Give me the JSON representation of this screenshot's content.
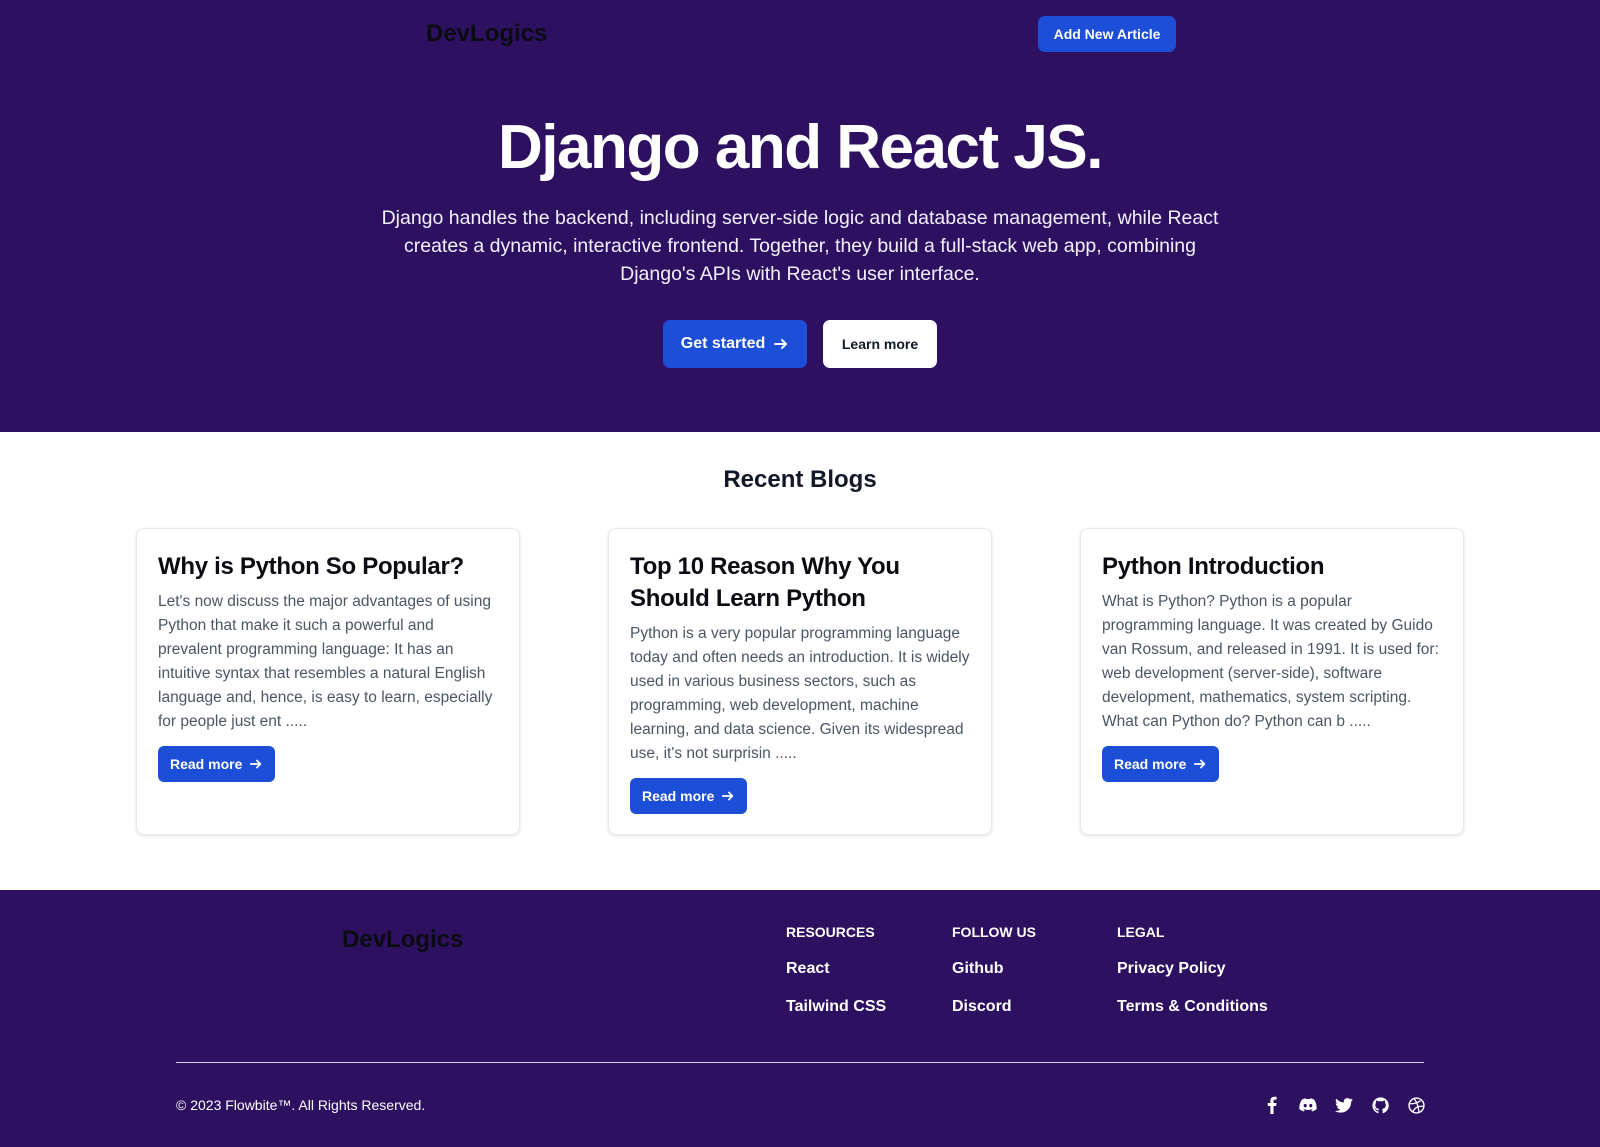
{
  "header": {
    "brand": "DevLogics",
    "add_article": "Add New Article"
  },
  "hero": {
    "title": "Django and React JS.",
    "subtitle": "Django handles the backend, including server-side logic and database management, while React creates a dynamic, interactive frontend. Together, they build a full-stack web app, combining Django's APIs with React's user interface.",
    "get_started": "Get started",
    "learn_more": "Learn more"
  },
  "blogs": {
    "title": "Recent Blogs",
    "read_more": "Read more",
    "items": [
      {
        "title": "Why is Python So Popular?",
        "excerpt": "Let's now discuss the major advantages of using Python that make it such a powerful and prevalent programming language: It has an intuitive syntax that resembles a natural English language and, hence, is easy to learn, especially for people just ent ....."
      },
      {
        "title": "Top 10 Reason Why You Should Learn Python",
        "excerpt": "Python is a very popular programming language today and often needs an introduction. It is widely used in various business sectors, such as programming, web development, machine learning, and data science. Given its widespread use, it's not surprisin ....."
      },
      {
        "title": "Python Introduction",
        "excerpt": "What is Python? Python is a popular programming language. It was created by Guido van Rossum, and released in 1991. It is used for: web development (server-side), software development, mathematics, system scripting. What can Python do? Python can b ....."
      }
    ]
  },
  "footer": {
    "brand": "DevLogics",
    "resources": {
      "heading": "RESOURCES",
      "links": [
        "React",
        "Tailwind CSS"
      ]
    },
    "follow": {
      "heading": "FOLLOW US",
      "links": [
        "Github",
        "Discord"
      ]
    },
    "legal": {
      "heading": "LEGAL",
      "links": [
        "Privacy Policy",
        "Terms & Conditions"
      ]
    },
    "copyright": "© 2023 Flowbite™. All Rights Reserved.",
    "socials": [
      "facebook-icon",
      "discord-icon",
      "twitter-icon",
      "github-icon",
      "dribbble-icon"
    ]
  },
  "colors": {
    "brand_purple": "#2d1160",
    "primary_blue": "#1d4ed8"
  }
}
